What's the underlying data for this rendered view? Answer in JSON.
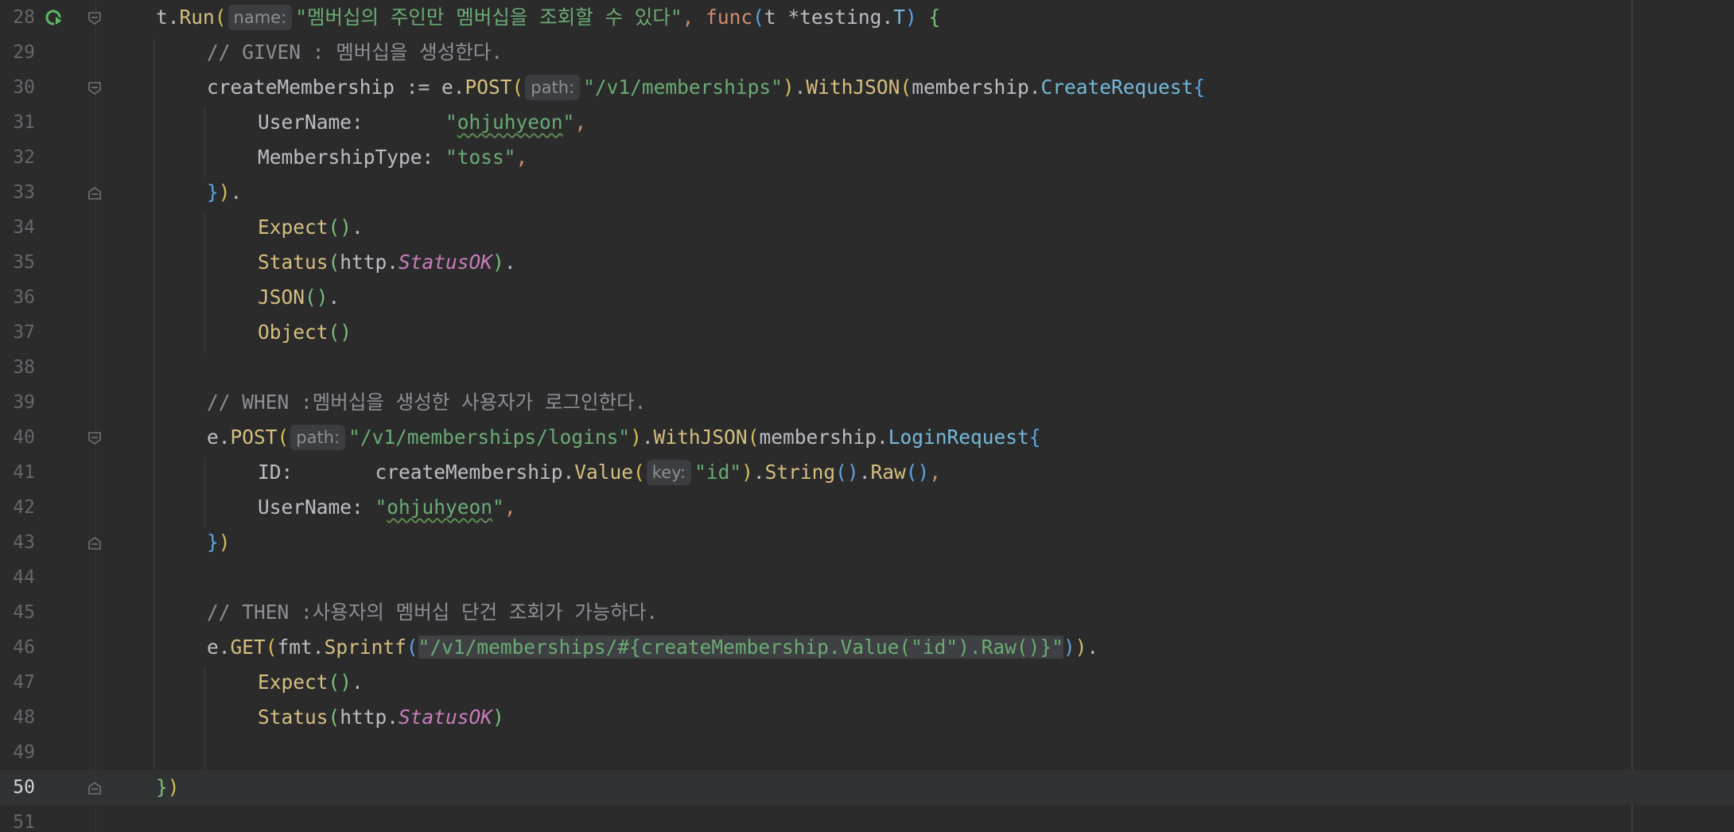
{
  "editor": {
    "current_line": 50,
    "lines": [
      {
        "n": "28",
        "tokens": [
          [
            "plain",
            "t."
          ],
          [
            "meth",
            "Run"
          ],
          [
            "p1",
            "("
          ],
          [
            "hint",
            "name:"
          ],
          [
            "str",
            "\"멤버십의 주인만 멤버십을 조회할 수 있다\""
          ],
          [
            "kw",
            ", func"
          ],
          [
            "p2",
            "("
          ],
          [
            "plain",
            "t *"
          ],
          [
            "pkg",
            "testing"
          ],
          [
            "plain",
            "."
          ],
          [
            "typeblue",
            "T"
          ],
          [
            "p2",
            ")"
          ],
          [
            "plain",
            " "
          ],
          [
            "p3",
            "{"
          ]
        ]
      },
      {
        "n": "29",
        "tokens": [
          [
            "cmt",
            "// GIVEN : 멤버십을 생성한다."
          ]
        ]
      },
      {
        "n": "30",
        "tokens": [
          [
            "plain",
            "createMembership := e."
          ],
          [
            "meth",
            "POST"
          ],
          [
            "p1",
            "("
          ],
          [
            "hint",
            "path:"
          ],
          [
            "str",
            "\"/v1/memberships\""
          ],
          [
            "p1",
            ")"
          ],
          [
            "plain",
            "."
          ],
          [
            "meth",
            "WithJSON"
          ],
          [
            "p1",
            "("
          ],
          [
            "plain",
            "membership."
          ],
          [
            "typeblue",
            "CreateRequest"
          ],
          [
            "p2",
            "{"
          ]
        ]
      },
      {
        "n": "31",
        "tokens": [
          [
            "plain",
            "UserName:       "
          ],
          [
            "str",
            "\""
          ],
          [
            "str typo",
            "ohjuhyeon"
          ],
          [
            "str",
            "\""
          ],
          [
            "kw",
            ","
          ]
        ]
      },
      {
        "n": "32",
        "tokens": [
          [
            "plain",
            "MembershipType: "
          ],
          [
            "str",
            "\"toss\""
          ],
          [
            "kw",
            ","
          ]
        ]
      },
      {
        "n": "33",
        "tokens": [
          [
            "p2",
            "}"
          ],
          [
            "p1",
            ")"
          ],
          [
            "plain",
            "."
          ]
        ]
      },
      {
        "n": "34",
        "tokens": [
          [
            "meth",
            "Expect"
          ],
          [
            "p3",
            "()"
          ],
          [
            "plain",
            "."
          ]
        ]
      },
      {
        "n": "35",
        "tokens": [
          [
            "meth",
            "Status"
          ],
          [
            "p3",
            "("
          ],
          [
            "plain",
            "http."
          ],
          [
            "konst",
            "StatusOK"
          ],
          [
            "p3",
            ")"
          ],
          [
            "plain",
            "."
          ]
        ]
      },
      {
        "n": "36",
        "tokens": [
          [
            "meth",
            "JSON"
          ],
          [
            "p3",
            "()"
          ],
          [
            "plain",
            "."
          ]
        ]
      },
      {
        "n": "37",
        "tokens": [
          [
            "meth",
            "Object"
          ],
          [
            "p3",
            "()"
          ]
        ]
      },
      {
        "n": "38",
        "tokens": []
      },
      {
        "n": "39",
        "tokens": [
          [
            "cmt",
            "// WHEN :멤버십을 생성한 사용자가 로그인한다."
          ]
        ]
      },
      {
        "n": "40",
        "tokens": [
          [
            "plain",
            "e."
          ],
          [
            "meth",
            "POST"
          ],
          [
            "p1",
            "("
          ],
          [
            "hint",
            "path:"
          ],
          [
            "str",
            "\"/v1/memberships/logins\""
          ],
          [
            "p1",
            ")"
          ],
          [
            "plain",
            "."
          ],
          [
            "meth",
            "WithJSON"
          ],
          [
            "p1",
            "("
          ],
          [
            "plain",
            "membership."
          ],
          [
            "typeblue",
            "LoginRequest"
          ],
          [
            "p2",
            "{"
          ]
        ]
      },
      {
        "n": "41",
        "tokens": [
          [
            "plain",
            "ID:       createMembership."
          ],
          [
            "meth",
            "Value"
          ],
          [
            "p1",
            "("
          ],
          [
            "hint",
            "key:"
          ],
          [
            "str",
            "\"id\""
          ],
          [
            "p1",
            ")"
          ],
          [
            "plain",
            "."
          ],
          [
            "meth",
            "String"
          ],
          [
            "p2",
            "()"
          ],
          [
            "plain",
            "."
          ],
          [
            "meth",
            "Raw"
          ],
          [
            "p2",
            "()"
          ],
          [
            "kw",
            ","
          ]
        ]
      },
      {
        "n": "42",
        "tokens": [
          [
            "plain",
            "UserName: "
          ],
          [
            "str",
            "\""
          ],
          [
            "str typo",
            "ohjuhyeon"
          ],
          [
            "str",
            "\""
          ],
          [
            "kw",
            ","
          ]
        ]
      },
      {
        "n": "43",
        "tokens": [
          [
            "p2",
            "}"
          ],
          [
            "p1",
            ")"
          ]
        ]
      },
      {
        "n": "44",
        "tokens": []
      },
      {
        "n": "45",
        "tokens": [
          [
            "cmt",
            "// THEN :사용자의 멤버십 단건 조회가 가능하다."
          ]
        ]
      },
      {
        "n": "46",
        "tokens": [
          [
            "plain",
            "e."
          ],
          [
            "meth",
            "GET"
          ],
          [
            "p1",
            "("
          ],
          [
            "plain",
            "fmt."
          ],
          [
            "meth",
            "Sprintf"
          ],
          [
            "p2",
            "("
          ],
          [
            "str sel",
            "\"/v1/memberships/#{createMembership.Value(\"id\").Raw()}\""
          ],
          [
            "p2",
            ")"
          ],
          [
            "p1",
            ")"
          ],
          [
            "plain",
            "."
          ]
        ]
      },
      {
        "n": "47",
        "tokens": [
          [
            "meth",
            "Expect"
          ],
          [
            "p3",
            "()"
          ],
          [
            "plain",
            "."
          ]
        ]
      },
      {
        "n": "48",
        "tokens": [
          [
            "meth",
            "Status"
          ],
          [
            "p3",
            "("
          ],
          [
            "plain",
            "http."
          ],
          [
            "konst",
            "StatusOK"
          ],
          [
            "p3",
            ")"
          ]
        ]
      },
      {
        "n": "49",
        "tokens": []
      },
      {
        "n": "50",
        "tokens": [
          [
            "p3",
            "}"
          ],
          [
            "p1",
            ")"
          ]
        ]
      },
      {
        "n": "51",
        "tokens": []
      }
    ]
  },
  "gutter": {
    "run_icon": "run-test-icon",
    "fold_icon": "fold-marker-icon",
    "run_color": "#5fb865"
  },
  "colors": {
    "background": "#2b2b2c",
    "current_line": "#313234",
    "string": "#6aab73",
    "keyword": "#cf8e6d",
    "method": "#d6bf80",
    "comment": "#8c8f94",
    "constant": "#c77dbb"
  }
}
